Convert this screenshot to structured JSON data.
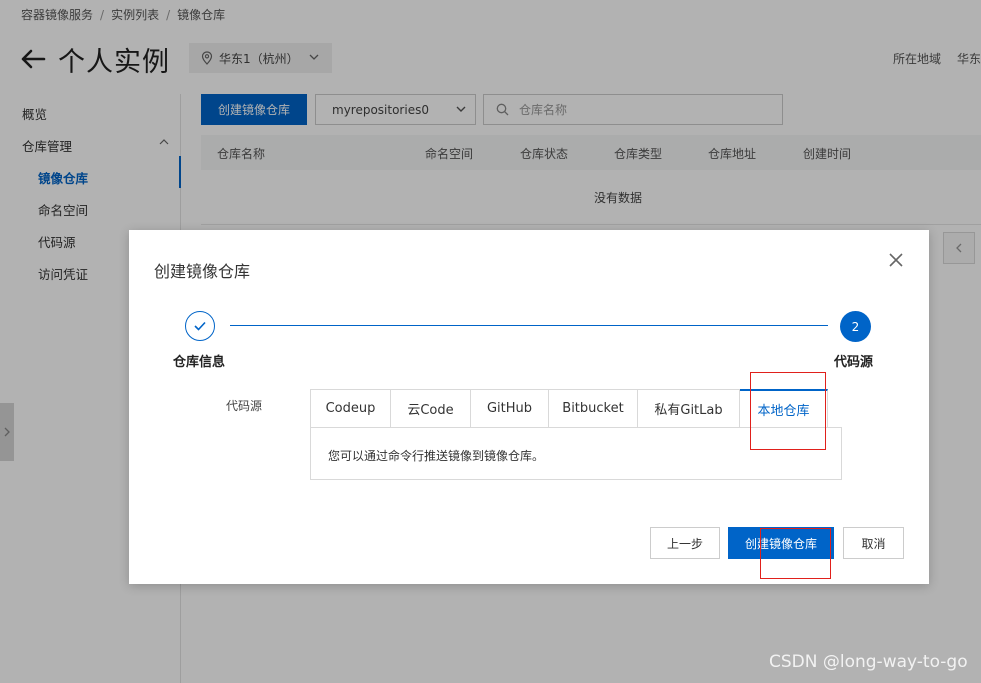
{
  "breadcrumb": {
    "items": [
      "容器镜像服务",
      "实例列表",
      "镜像仓库"
    ],
    "separator": "/"
  },
  "header": {
    "title": "个人实例",
    "region": "华东1（杭州）",
    "right_label": "所在地域",
    "right_value_partial": "华东"
  },
  "sidebar": {
    "overview": "概览",
    "repo_mgmt": "仓库管理",
    "items": [
      "镜像仓库",
      "命名空间",
      "代码源",
      "访问凭证"
    ],
    "active_index": 0
  },
  "toolbar": {
    "create_button": "创建镜像仓库",
    "namespace_value": "myrepositories0",
    "search_placeholder": "仓库名称"
  },
  "table": {
    "columns": [
      "仓库名称",
      "命名空间",
      "仓库状态",
      "仓库类型",
      "仓库地址",
      "创建时间"
    ],
    "empty_text": "没有数据"
  },
  "modal": {
    "title": "创建镜像仓库",
    "steps": [
      {
        "label": "仓库信息",
        "state": "done"
      },
      {
        "label": "代码源",
        "number": "2",
        "state": "current"
      }
    ],
    "field_label": "代码源",
    "tabs": [
      "Codeup",
      "云Code",
      "GitHub",
      "Bitbucket",
      "私有GitLab",
      "本地仓库"
    ],
    "active_tab_index": 5,
    "panel_text": "您可以通过命令行推送镜像到镜像仓库。",
    "buttons": {
      "prev": "上一步",
      "create": "创建镜像仓库",
      "cancel": "取消"
    }
  },
  "watermark": "CSDN @long-way-to-go",
  "colors": {
    "primary": "#0064c8",
    "highlight_box": "#e0201b",
    "overlay": "rgba(0,0,0,0.30)"
  },
  "icons": [
    "back-arrow-icon",
    "location-pin-icon",
    "chevron-down-icon",
    "chevron-up-icon",
    "search-icon",
    "chevron-left-icon",
    "chevron-right-icon",
    "close-icon",
    "check-icon"
  ]
}
